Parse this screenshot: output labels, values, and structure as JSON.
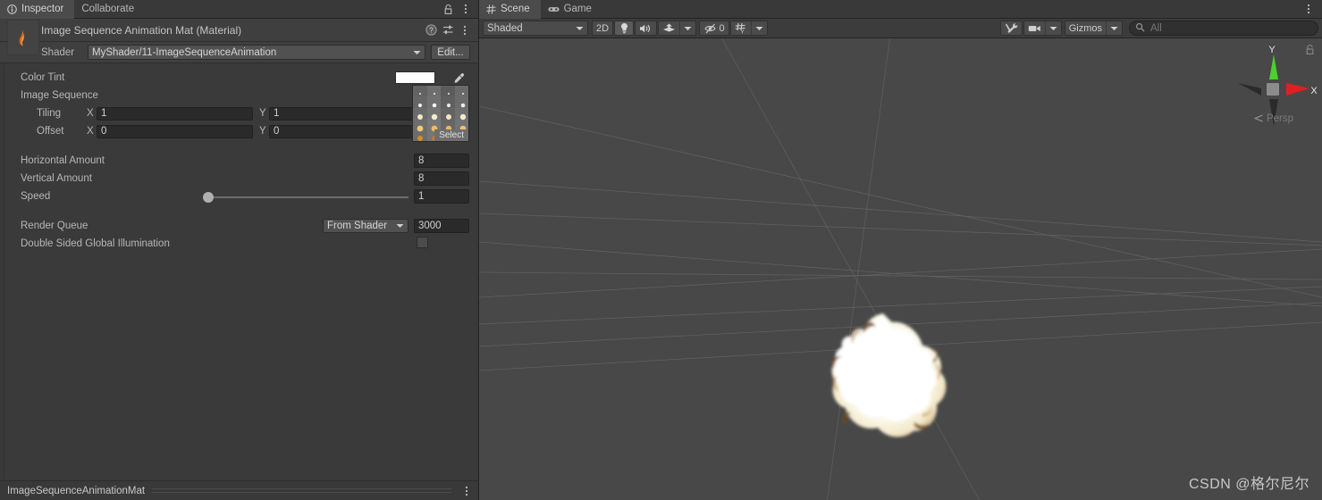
{
  "inspector": {
    "tabs": [
      {
        "label": "Inspector",
        "icon": "info-icon",
        "active": true
      },
      {
        "label": "Collaborate",
        "icon": "",
        "active": false
      }
    ],
    "header_icons": [
      "lock-icon",
      "more-menu-icon"
    ],
    "material": {
      "title": "Image Sequence Animation Mat (Material)",
      "icons": [
        "help-icon",
        "preset-icon",
        "more-menu-icon"
      ],
      "shader_label": "Shader",
      "shader_value": "MyShader/11-ImageSequenceAnimation",
      "edit_button": "Edit..."
    },
    "properties": {
      "color_tint_label": "Color Tint",
      "color_tint_value": "#FFFFFF",
      "image_sequence_label": "Image Sequence",
      "texture_select_label": "Select",
      "tiling_label": "Tiling",
      "tiling_x_axis": "X",
      "tiling_x": "1",
      "tiling_y_axis": "Y",
      "tiling_y": "1",
      "offset_label": "Offset",
      "offset_x_axis": "X",
      "offset_x": "0",
      "offset_y_axis": "Y",
      "offset_y": "0",
      "horizontal_amount_label": "Horizontal Amount",
      "horizontal_amount": "8",
      "vertical_amount_label": "Vertical Amount",
      "vertical_amount": "8",
      "speed_label": "Speed",
      "speed": "1",
      "render_queue_label": "Render Queue",
      "render_queue_mode": "From Shader",
      "render_queue_value": "3000",
      "double_sided_gi_label": "Double Sided Global Illumination",
      "double_sided_gi_checked": false
    },
    "asset_bar": {
      "name": "ImageSequenceAnimationMat",
      "menu_icon": "more-menu-icon"
    }
  },
  "scene": {
    "tabs": [
      {
        "label": "Scene",
        "icon": "grid-icon",
        "active": true
      },
      {
        "label": "Game",
        "icon": "gamepad-icon",
        "active": false
      }
    ],
    "toolbar": {
      "draw_mode": "Shaded",
      "two_d_button": "2D",
      "lighting_icon": "lightbulb-icon",
      "audio_icon": "speaker-icon",
      "fx_icon": "fx-layers-icon",
      "fx_caret": "chevron-down-icon",
      "hidden_objects_icon": "eye-off-icon",
      "hidden_objects_count": "0",
      "grid_icon": "grid-axis-icon",
      "grid_caret": "chevron-down-icon",
      "tools_icon": "tools-icon",
      "camera_icon": "camera-icon",
      "camera_caret": "chevron-down-icon",
      "gizmos_label": "Gizmos",
      "gizmos_caret": "chevron-down-icon",
      "search_icon": "search-icon",
      "search_placeholder": "All",
      "search_value": ""
    },
    "gizmo": {
      "axis_x": "X",
      "axis_y": "Y",
      "projection": "Persp",
      "projection_caret": "chevron-left-icon",
      "lock_icon": "lock-icon",
      "color_x": "#e02020",
      "color_y": "#4bd12a",
      "color_z": "#2a2a2a"
    },
    "watermark": "CSDN @格尔尼尔"
  },
  "theme": {
    "panel_bg": "#393939",
    "props_bg": "#3a3a3a",
    "scene_bg": "#484848",
    "field_bg": "#2a2a2a",
    "button_bg": "#4b4b4b",
    "text": "#b7b7b7",
    "text_bright": "#d6d6d6",
    "border": "#232323"
  }
}
